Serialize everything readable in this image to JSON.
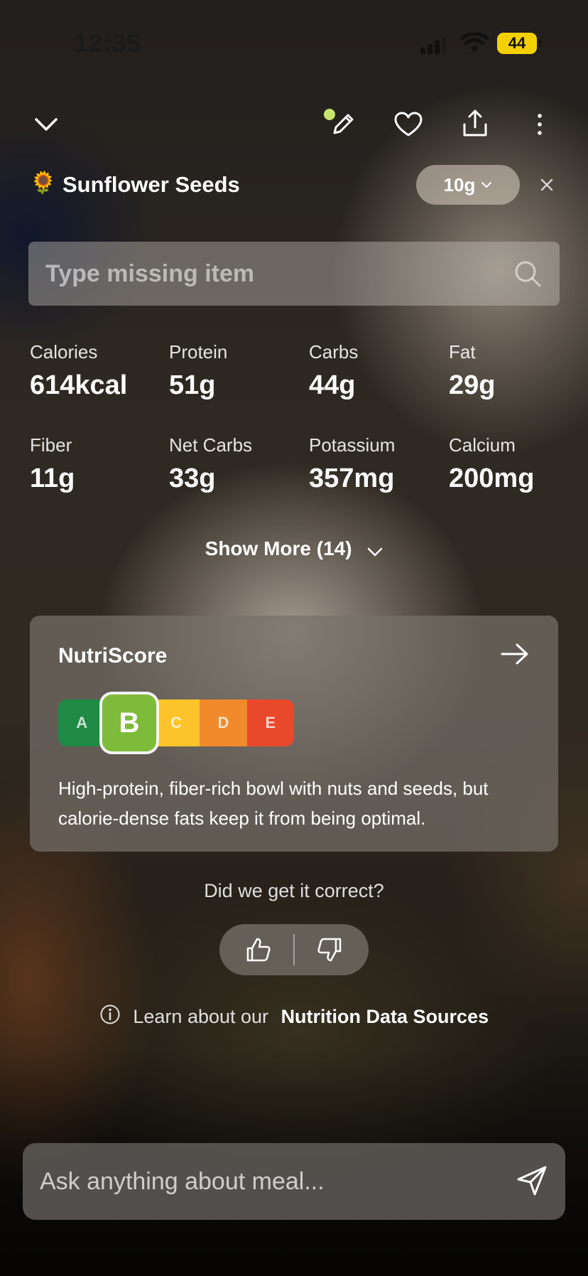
{
  "status_bar": {
    "time": "12:35",
    "battery": "44"
  },
  "toolbar": {
    "collapse_icon": "chevron-down-icon",
    "edit_icon": "pencil-icon",
    "favorite_icon": "heart-icon",
    "share_icon": "share-icon",
    "more_icon": "more-vertical-icon"
  },
  "food_item": {
    "emoji": "🌻",
    "name": "Sunflower Seeds",
    "portion": "10g"
  },
  "missing_item": {
    "placeholder": "Type missing item"
  },
  "nutrients": [
    {
      "label": "Calories",
      "value": "614kcal"
    },
    {
      "label": "Protein",
      "value": "51g"
    },
    {
      "label": "Carbs",
      "value": "44g"
    },
    {
      "label": "Fat",
      "value": "29g"
    },
    {
      "label": "Fiber",
      "value": "11g"
    },
    {
      "label": "Net Carbs",
      "value": "33g"
    },
    {
      "label": "Potassium",
      "value": "357mg"
    },
    {
      "label": "Calcium",
      "value": "200mg"
    }
  ],
  "show_more": "Show More (14)",
  "nutriscore": {
    "title": "NutriScore",
    "grades": [
      "A",
      "B",
      "C",
      "D",
      "E"
    ],
    "selected": "B",
    "grade_colors": [
      "#1e8a43",
      "#7fbb3a",
      "#fcc42a",
      "#f08a2a",
      "#e9482b"
    ],
    "description": "High-protein, fiber-rich bowl with nuts and seeds, but calorie-dense fats keep it from being optimal."
  },
  "feedback": {
    "question": "Did we get it correct?"
  },
  "learn": {
    "prefix": "Learn about our",
    "link": "Nutrition Data Sources"
  },
  "ask": {
    "placeholder": "Ask anything about meal..."
  }
}
